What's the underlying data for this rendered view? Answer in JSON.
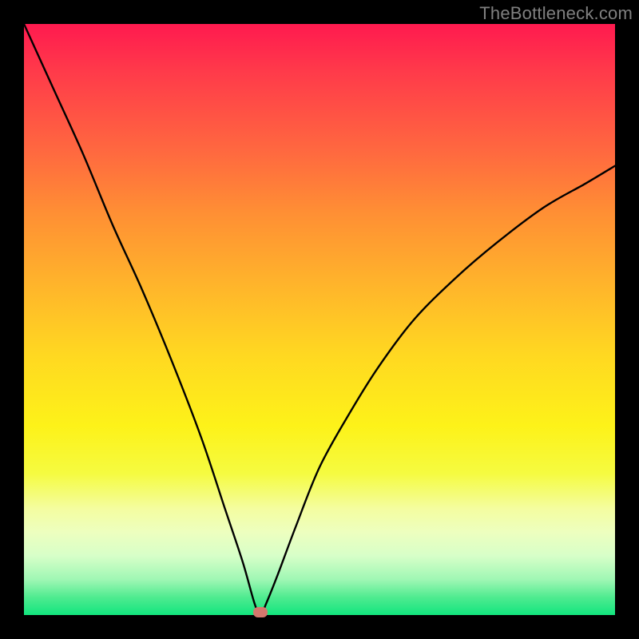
{
  "watermark": "TheBottleneck.com",
  "chart_data": {
    "type": "line",
    "title": "",
    "xlabel": "",
    "ylabel": "",
    "xlim": [
      0,
      1
    ],
    "ylim": [
      0,
      1
    ],
    "grid": false,
    "annotations": [
      {
        "name": "optimum-marker",
        "x": 0.4,
        "y": 0.0,
        "color": "#d4776d"
      }
    ],
    "series": [
      {
        "name": "bottleneck-curve",
        "x": [
          0.0,
          0.05,
          0.1,
          0.15,
          0.2,
          0.25,
          0.3,
          0.34,
          0.37,
          0.39,
          0.4,
          0.41,
          0.43,
          0.46,
          0.5,
          0.55,
          0.6,
          0.66,
          0.73,
          0.8,
          0.88,
          0.95,
          1.0
        ],
        "values": [
          1.0,
          0.89,
          0.78,
          0.66,
          0.55,
          0.43,
          0.3,
          0.18,
          0.09,
          0.02,
          0.0,
          0.02,
          0.07,
          0.15,
          0.25,
          0.34,
          0.42,
          0.5,
          0.57,
          0.63,
          0.69,
          0.73,
          0.76
        ]
      }
    ],
    "background_gradient": {
      "top": "#ff1a4f",
      "mid": "#ffd821",
      "bottom": "#12e57e"
    }
  }
}
